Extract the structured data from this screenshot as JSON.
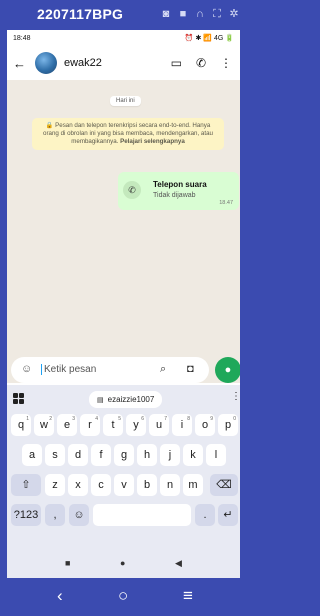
{
  "mirror": {
    "title": "2207117BPG",
    "icons": [
      "camera-icon",
      "video-icon",
      "headphones-icon",
      "fullscreen-icon",
      "settings-icon"
    ]
  },
  "status_bar": {
    "time": "18:48",
    "right": "⏰ ✱ 📶 4G 🔋"
  },
  "header": {
    "contact_name": "ewak22",
    "back_glyph": "←",
    "video_glyph": "▭",
    "call_glyph": "✆",
    "menu_glyph": "⋮"
  },
  "chat": {
    "date_chip": "Hari ini",
    "encryption_note": "Pesan dan telepon terenkripsi secara end-to-end. Hanya orang di obrolan ini yang bisa membaca, mendengarkan, atau membagikannya.",
    "encryption_link": "Pelajari selengkapnya",
    "call_title": "Telepon suara",
    "call_subtitle": "Tidak dijawab",
    "call_time": "18.47"
  },
  "composer": {
    "placeholder": "Ketik pesan"
  },
  "keyboard": {
    "clipboard_suggestion": "ezaizzie1007",
    "row1": [
      {
        "k": "q",
        "s": "1"
      },
      {
        "k": "w",
        "s": "2"
      },
      {
        "k": "e",
        "s": "3"
      },
      {
        "k": "r",
        "s": "4"
      },
      {
        "k": "t",
        "s": "5"
      },
      {
        "k": "y",
        "s": "6"
      },
      {
        "k": "u",
        "s": "7"
      },
      {
        "k": "i",
        "s": "8"
      },
      {
        "k": "o",
        "s": "9"
      },
      {
        "k": "p",
        "s": "0"
      }
    ],
    "row2": [
      "a",
      "s",
      "d",
      "f",
      "g",
      "h",
      "j",
      "k",
      "l"
    ],
    "row3": [
      "z",
      "x",
      "c",
      "v",
      "b",
      "n",
      "m"
    ],
    "symbols_label": "?123",
    "comma_label": ",",
    "period_label": "."
  },
  "colors": {
    "accent": "#1fa85a",
    "tool_bar": "#3b4bb0",
    "chat_background": "#efeae2",
    "outgoing_bubble": "#d9fdd3",
    "encryption_note_bg": "#fdf4c5"
  }
}
